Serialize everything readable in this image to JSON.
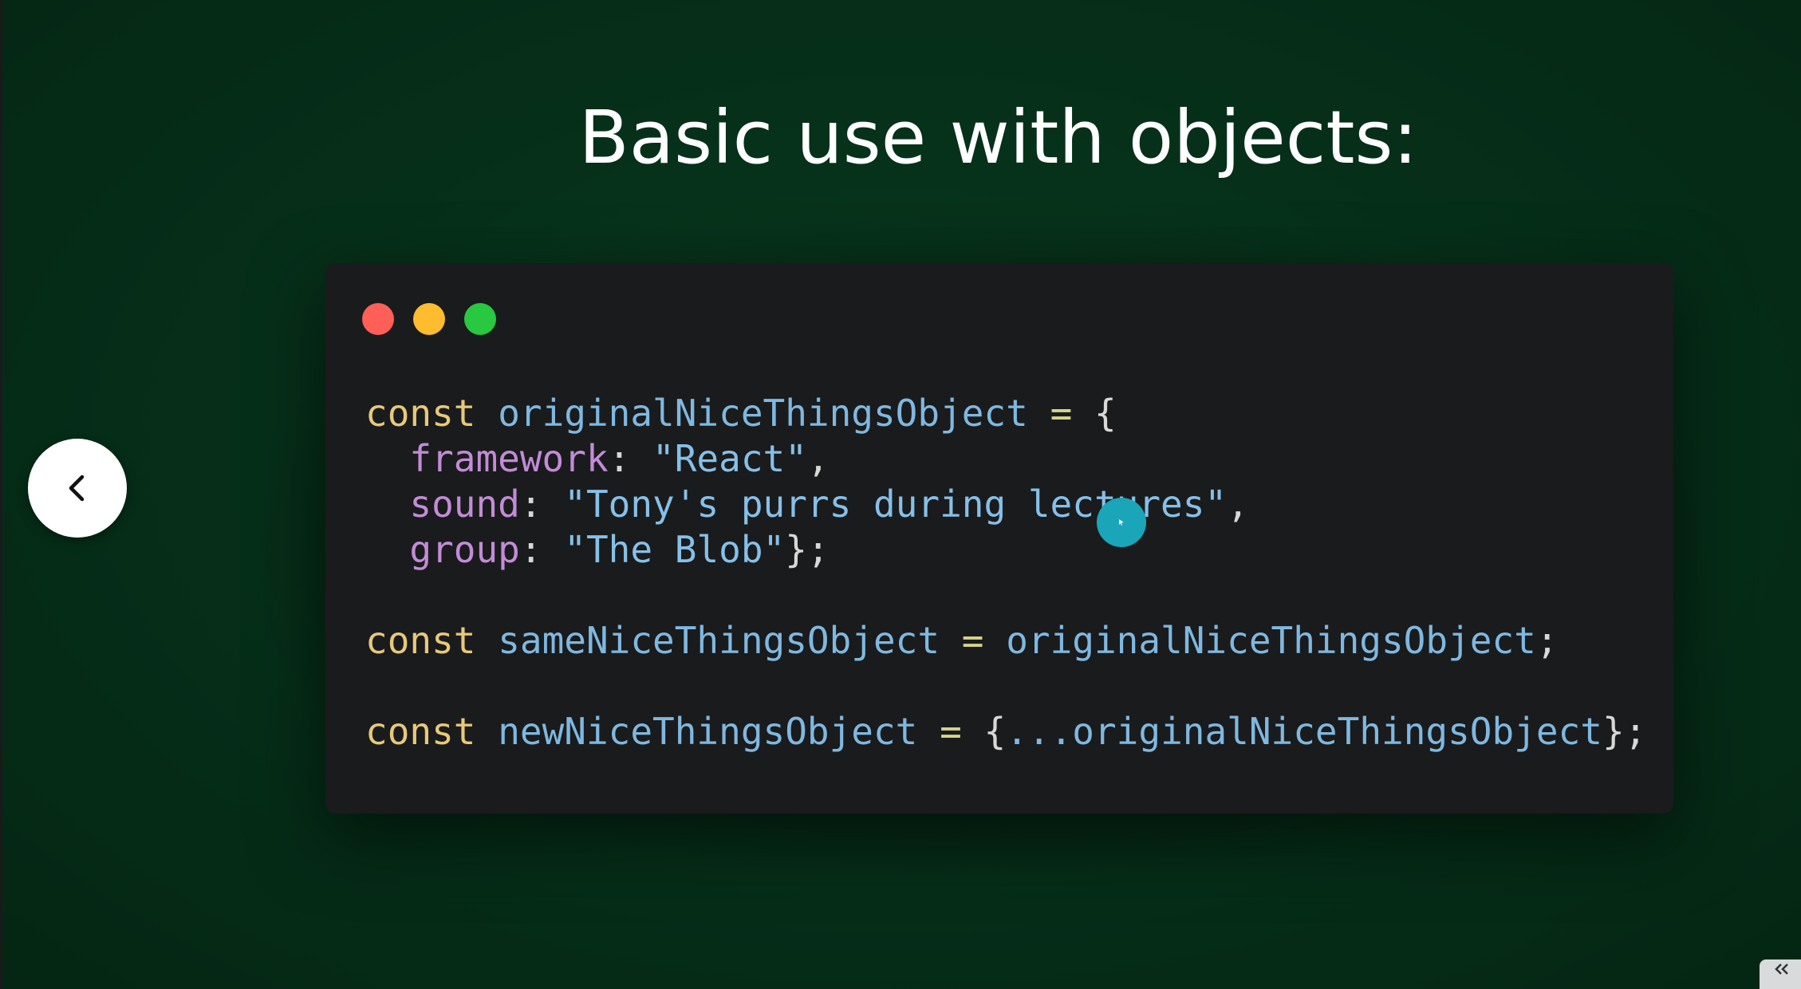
{
  "slide": {
    "title": "Basic use with objects:",
    "background_color": "#06301a"
  },
  "code_window": {
    "window_controls": [
      {
        "name": "close-dot",
        "color": "#ff5f57"
      },
      {
        "name": "minimize-dot",
        "color": "#febc2e"
      },
      {
        "name": "maximize-dot",
        "color": "#28c840"
      }
    ],
    "background_color": "#1a1b1d",
    "language": "javascript",
    "code_lines": [
      "const originalNiceThingsObject = {",
      "  framework: \"React\",",
      "  sound: \"Tony's purrs during lectures\",",
      "  group: \"The Blob\"};",
      "",
      "const sameNiceThingsObject = originalNiceThingsObject;",
      "",
      "const newNiceThingsObject = {...originalNiceThingsObject};"
    ],
    "tokens": {
      "l1_kw": "const",
      "l1_id": "originalNiceThingsObject",
      "l1_op": "=",
      "l1_brace": "{",
      "l2_prop": "framework",
      "l2_colon": ":",
      "l2_str": "\"React\"",
      "l2_comma": ",",
      "l3_prop": "sound",
      "l3_colon": ":",
      "l3_str": "\"Tony's purrs during lectures\"",
      "l3_comma": ",",
      "l4_prop": "group",
      "l4_colon": ":",
      "l4_str": "\"The Blob\"",
      "l4_end": "};",
      "l6_kw": "const",
      "l6_id": "sameNiceThingsObject",
      "l6_op": "=",
      "l6_ref": "originalNiceThingsObject",
      "l6_end": ";",
      "l8_kw": "const",
      "l8_id": "newNiceThingsObject",
      "l8_op": "=",
      "l8_brace_open": "{",
      "l8_spread": "...",
      "l8_ref": "originalNiceThingsObject",
      "l8_end": "};"
    }
  },
  "navigation": {
    "prev_icon": "chevron-left-icon"
  },
  "pointer": {
    "icon": "cursor-highlight-icon",
    "color": "#1aa5b8"
  },
  "corner_widget": {
    "icon": "collapse-icon"
  }
}
